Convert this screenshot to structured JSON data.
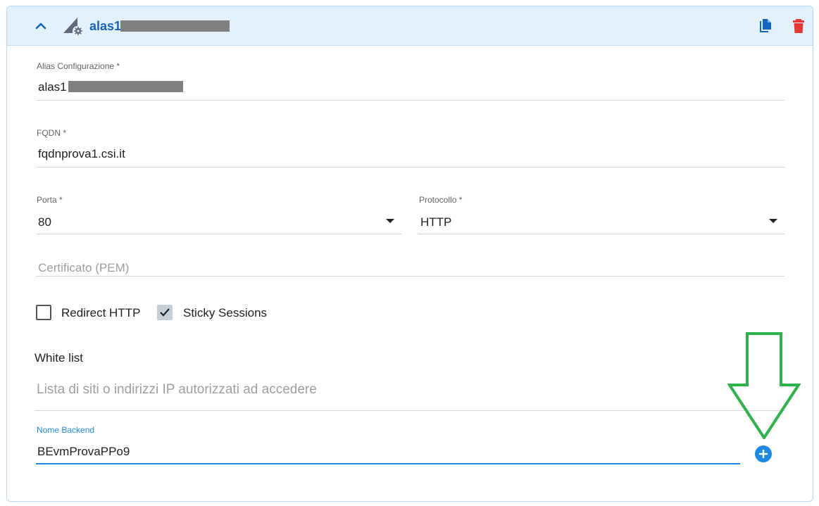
{
  "header": {
    "title": "alas1",
    "icons": {
      "collapse": "chevron-up-icon",
      "type": "network-settings-icon",
      "copy": "copy-icon",
      "delete": "trash-icon"
    },
    "colors": {
      "accent": "#1565c0",
      "delete": "#e53935",
      "header_bg": "#e3f1fd"
    }
  },
  "form": {
    "alias": {
      "label": "Alias Configurazione *",
      "value": "alas1"
    },
    "fqdn": {
      "label": "FQDN *",
      "value": "fqdnprova1.csi.it"
    },
    "porta": {
      "label": "Porta *",
      "value": "80"
    },
    "protocollo": {
      "label": "Protocollo *",
      "value": "HTTP"
    },
    "certificato": {
      "placeholder": "Certificato (PEM)"
    },
    "redirect_http": {
      "label": "Redirect HTTP",
      "checked": false
    },
    "sticky_sessions": {
      "label": "Sticky Sessions",
      "checked": true
    },
    "whitelist": {
      "title": "White list",
      "placeholder": "Lista di siti o indirizzi IP autorizzati ad accedere"
    },
    "backend": {
      "label": "Nome Backend",
      "value": "BEvmProvaPPo9"
    }
  },
  "add_button": {
    "icon": "plus-circle-icon",
    "color": "#1e88e5"
  },
  "annotation": {
    "icon": "arrow-down-icon",
    "color": "#2db34a"
  }
}
